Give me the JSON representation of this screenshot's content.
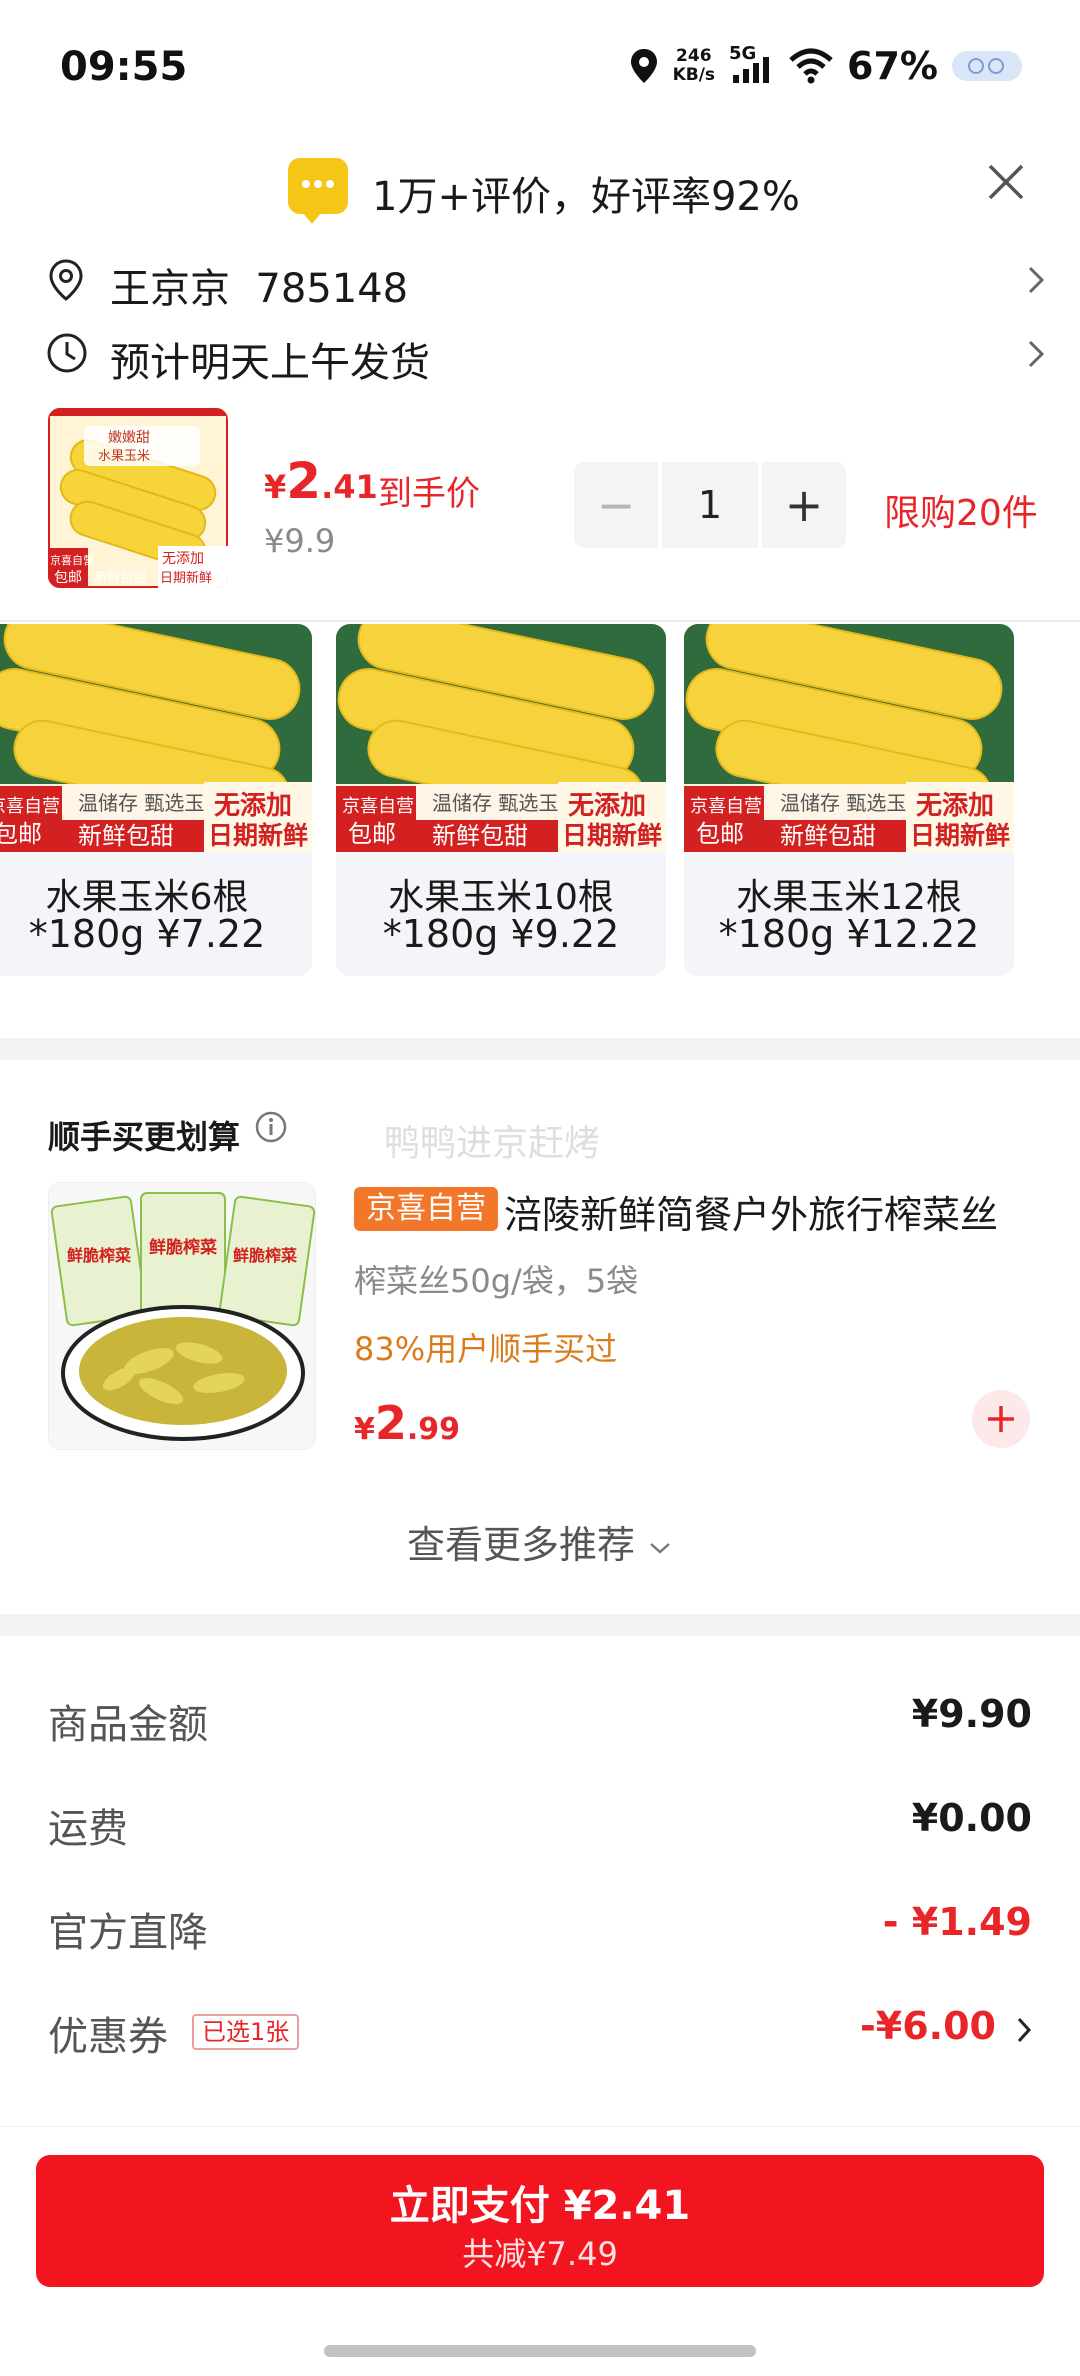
{
  "status_bar": {
    "time": "09:55",
    "speed_value": "246",
    "speed_unit": "KB/s",
    "network": "5G",
    "battery": "67%"
  },
  "review_banner": {
    "text": "1万+评价，好评率92%"
  },
  "address": {
    "name_line": "王京京  785148",
    "delivery": "预计明天上午发货"
  },
  "product": {
    "price_currency": "¥",
    "price_int": "2",
    "price_dec": ".41",
    "price_label": "到手价",
    "original_price": "¥9.9",
    "quantity": "1",
    "minus": "−",
    "plus": "+",
    "limit": "限购20件"
  },
  "variants": [
    {
      "name": "水果玉米6根",
      "spec": "*180g ¥7.22"
    },
    {
      "name": "水果玉米10根",
      "spec": "*180g ¥9.22"
    },
    {
      "name": "水果玉米12根",
      "spec": "*180g ¥12.22"
    }
  ],
  "variant_image_text": {
    "badge_top": "京喜自营",
    "badge_bottom": "包邮",
    "strip": "温储存  甄选玉米",
    "fresh": "新鲜包甜",
    "no_add": "无添加",
    "date": "日期新鲜"
  },
  "thumb_image_text": {
    "top": "嫩嫩甜",
    "top2": "水果玉米",
    "badge_top": "京喜自营",
    "badge_bottom": "包邮",
    "no_add": "无添加",
    "date": "日期新鲜",
    "fresh": "新鲜包甜"
  },
  "recommend": {
    "title": "顺手买更划算",
    "watermark": "鸭鸭进京赶烤",
    "badge": "京喜自营",
    "name": "涪陵新鲜简餐户外旅行榨菜丝",
    "spec": "榨菜丝50g/袋，5袋",
    "stat": "83%用户顺手买过",
    "price_currency": "¥",
    "price_int": "2",
    "price_dec": ".99",
    "pack_label": "鲜脆榨菜",
    "more": "查看更多推荐"
  },
  "fees": [
    {
      "label": "商品金额",
      "value": "¥9.90"
    },
    {
      "label": "运费",
      "value": "¥0.00"
    },
    {
      "label": "官方直降",
      "value": "- ¥1.49"
    },
    {
      "label": "优惠券",
      "value": "-¥6.00",
      "tag": "已选1张"
    }
  ],
  "pay": {
    "main": "立即支付 ¥2.41",
    "sub": "共减¥7.49"
  },
  "colors": {
    "brand_red": "#e8262a",
    "pay_button": "#f2141e",
    "badge_orange": "#f2772a",
    "stat_orange": "#d97c1b"
  }
}
